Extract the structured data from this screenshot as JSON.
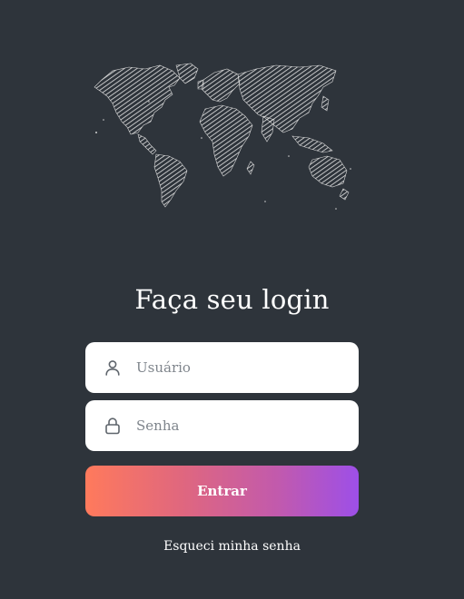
{
  "login": {
    "title": "Faça seu login",
    "username_placeholder": "Usuário",
    "password_placeholder": "Senha",
    "submit_label": "Entrar",
    "forgot_label": "Esqueci minha senha"
  },
  "icons": {
    "user": "user-icon",
    "lock": "lock-icon",
    "map": "world-map-icon"
  },
  "colors": {
    "background": "#2e343b",
    "field_background": "#ffffff",
    "gradient_start": "#ff7a5c",
    "gradient_end": "#9d4fe8",
    "placeholder": "#7f858c"
  }
}
